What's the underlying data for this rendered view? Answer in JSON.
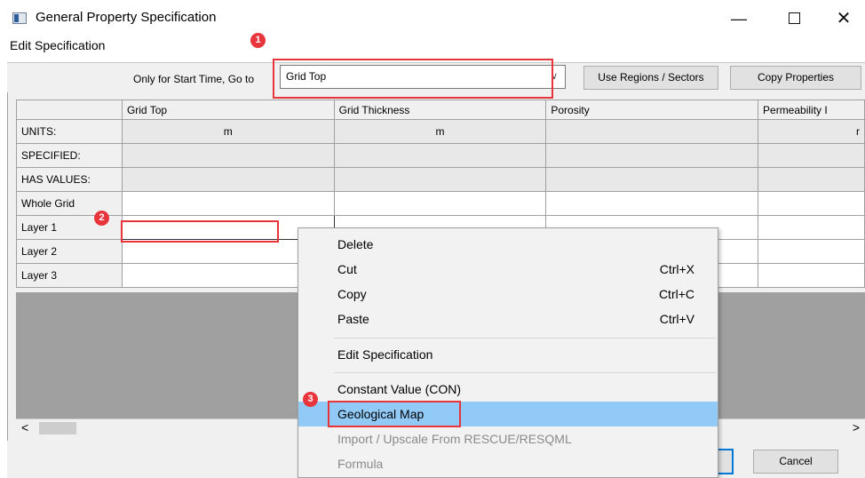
{
  "window": {
    "title": "General Property Specification",
    "minimize_glyph": "—",
    "close_glyph": "✕"
  },
  "menu": {
    "edit_specification": "Edit Specification"
  },
  "toolbar": {
    "goto_label": "Only for Start Time, Go to",
    "goto_value": "Grid Top",
    "use_regions": "Use Regions / Sectors",
    "copy_properties": "Copy Properties"
  },
  "grid": {
    "columns": [
      "Grid Top",
      "Grid Thickness",
      "Porosity",
      "Permeability I"
    ],
    "rows": {
      "units": {
        "label": "UNITS:",
        "values": [
          "m",
          "m",
          "",
          "r"
        ]
      },
      "specified": {
        "label": "SPECIFIED:"
      },
      "has_values": {
        "label": "HAS VALUES:"
      },
      "whole_grid": {
        "label": "Whole Grid"
      },
      "layer1": {
        "label": "Layer 1"
      },
      "layer2": {
        "label": "Layer 2"
      },
      "layer3": {
        "label": "Layer 3"
      }
    }
  },
  "scrollbar": {
    "left_arrow": "<",
    "right_arrow": ">"
  },
  "context_menu": {
    "items": [
      {
        "label": "Delete",
        "shortcut": ""
      },
      {
        "label": "Cut",
        "shortcut": "Ctrl+X"
      },
      {
        "label": "Copy",
        "shortcut": "Ctrl+C"
      },
      {
        "label": "Paste",
        "shortcut": "Ctrl+V"
      },
      {
        "label": "Edit Specification",
        "shortcut": ""
      },
      {
        "label": "Constant Value (CON)",
        "shortcut": ""
      },
      {
        "label": "Geological Map",
        "shortcut": ""
      },
      {
        "label": "Import / Upscale From RESCUE/RESQML",
        "shortcut": ""
      },
      {
        "label": "Formula",
        "shortcut": ""
      }
    ]
  },
  "footer": {
    "cancel": "Cancel"
  },
  "annotations": {
    "badge1": "1",
    "badge2": "2",
    "badge3": "3",
    "color": "#e8343b"
  }
}
